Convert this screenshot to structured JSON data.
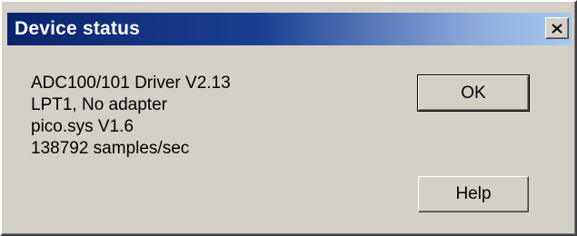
{
  "window": {
    "title": "Device status",
    "close_icon": "close-icon"
  },
  "info": {
    "lines": [
      "ADC100/101 Driver V2.13",
      "LPT1, No adapter",
      "pico.sys V1.6",
      "138792 samples/sec"
    ]
  },
  "buttons": {
    "ok_label": "OK",
    "help_label": "Help"
  },
  "colors": {
    "titlebar_start": "#0a246a",
    "titlebar_end": "#a6caf0",
    "face": "#d4d0c8"
  }
}
